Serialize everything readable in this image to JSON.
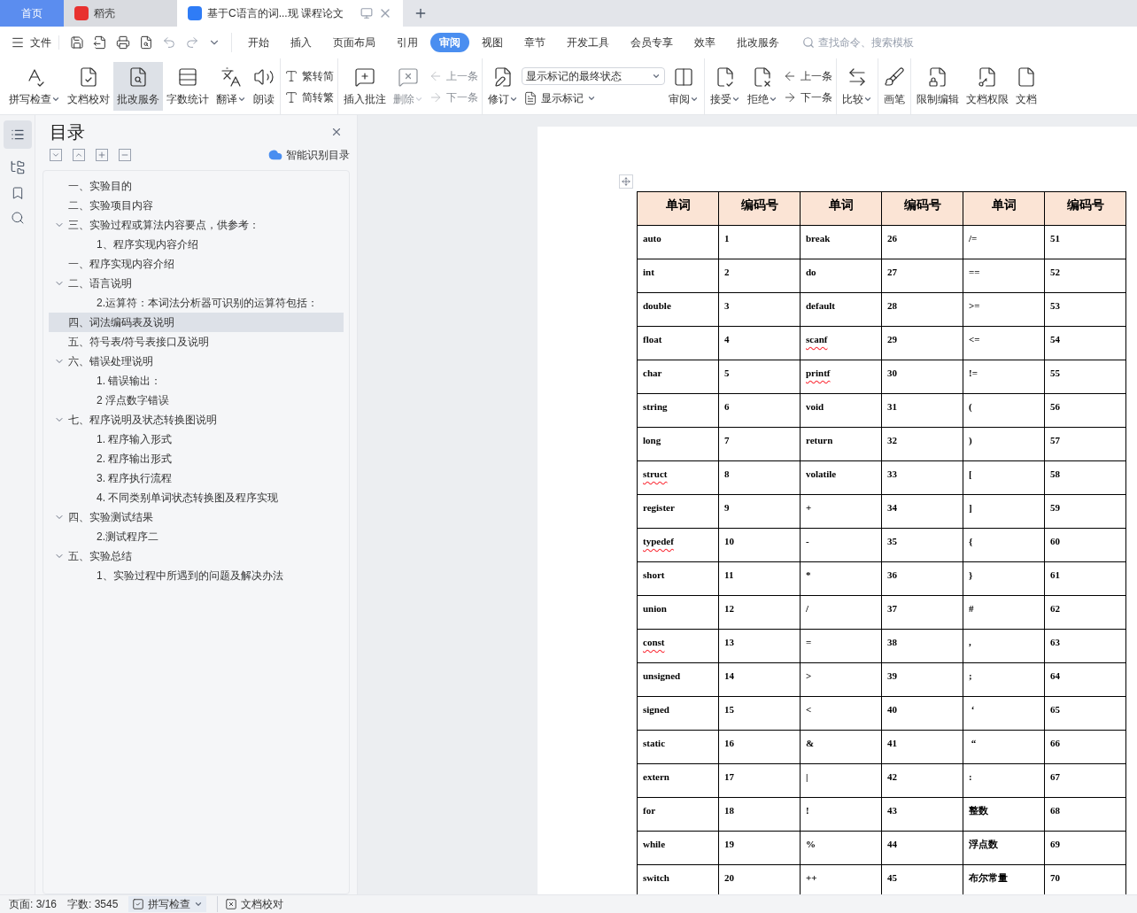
{
  "tabs": [
    {
      "label": "首页",
      "kind": "home",
      "selected": false
    },
    {
      "label": "稻壳",
      "kind": "app",
      "selected": false
    },
    {
      "label": "基于C语言的词...现  课程论文",
      "kind": "doc",
      "selected": true
    }
  ],
  "file_menu": "文件",
  "ribbon_tabs": [
    {
      "label": "开始",
      "selected": false
    },
    {
      "label": "插入",
      "selected": false
    },
    {
      "label": "页面布局",
      "selected": false
    },
    {
      "label": "引用",
      "selected": false
    },
    {
      "label": "审阅",
      "selected": true
    },
    {
      "label": "视图",
      "selected": false
    },
    {
      "label": "章节",
      "selected": false
    },
    {
      "label": "开发工具",
      "selected": false
    },
    {
      "label": "会员专享",
      "selected": false
    },
    {
      "label": "效率",
      "selected": false
    },
    {
      "label": "批改服务",
      "selected": false
    }
  ],
  "search": {
    "placeholder": "查找命令、搜索模板"
  },
  "ribbon_groups": [
    {
      "items": [
        {
          "kind": "large",
          "label": "拼写检查",
          "caret": true,
          "disabled": false,
          "selected": false
        },
        {
          "kind": "large",
          "label": "文档校对",
          "caret": false,
          "disabled": false,
          "selected": false
        },
        {
          "kind": "large",
          "label": "批改服务",
          "caret": false,
          "disabled": false,
          "selected": true
        },
        {
          "kind": "large",
          "label": "字数统计",
          "caret": false,
          "disabled": false,
          "selected": false
        },
        {
          "kind": "large",
          "label": "翻译",
          "caret": true,
          "disabled": false,
          "selected": false
        },
        {
          "kind": "large",
          "label": "朗读",
          "caret": false,
          "disabled": false,
          "selected": false
        }
      ]
    },
    {
      "items": [
        {
          "kind": "stack",
          "entries": [
            {
              "kind": "small",
              "label": "繁转简",
              "caret": false,
              "disabled": false
            },
            {
              "kind": "small",
              "label": "简转繁",
              "caret": false,
              "disabled": false
            }
          ]
        }
      ]
    },
    {
      "items": [
        {
          "kind": "large",
          "label": "插入批注",
          "caret": false,
          "disabled": false,
          "selected": false
        },
        {
          "kind": "large",
          "label": "删除",
          "caret": true,
          "disabled": true,
          "selected": false
        },
        {
          "kind": "stack",
          "entries": [
            {
              "kind": "small",
              "label": "上一条",
              "caret": false,
              "disabled": true
            },
            {
              "kind": "small",
              "label": "下一条",
              "caret": false,
              "disabled": true
            }
          ]
        }
      ]
    },
    {
      "items": [
        {
          "kind": "large",
          "label": "修订",
          "caret": true,
          "disabled": false,
          "selected": false
        },
        {
          "kind": "stack",
          "entries": [
            {
              "kind": "select",
              "label": "显示标记的最终状态"
            },
            {
              "kind": "small",
              "label": "显示标记",
              "caret": true,
              "disabled": false
            }
          ]
        },
        {
          "kind": "large",
          "label": "审阅",
          "caret": true,
          "disabled": false,
          "selected": false
        }
      ]
    },
    {
      "items": [
        {
          "kind": "large",
          "label": "接受",
          "caret": true,
          "disabled": false,
          "selected": false
        },
        {
          "kind": "large",
          "label": "拒绝",
          "caret": true,
          "disabled": false,
          "selected": false
        },
        {
          "kind": "stack",
          "entries": [
            {
              "kind": "small",
              "label": "上一条",
              "caret": false,
              "disabled": false
            },
            {
              "kind": "small",
              "label": "下一条",
              "caret": false,
              "disabled": false
            }
          ]
        }
      ]
    },
    {
      "items": [
        {
          "kind": "large",
          "label": "比较",
          "caret": true,
          "disabled": false,
          "selected": false
        }
      ]
    },
    {
      "items": [
        {
          "kind": "large",
          "label": "画笔",
          "caret": false,
          "disabled": false,
          "selected": false
        }
      ]
    },
    {
      "items": [
        {
          "kind": "large",
          "label": "限制编辑",
          "caret": false,
          "disabled": false,
          "selected": false
        },
        {
          "kind": "large",
          "label": "文档权限",
          "caret": false,
          "disabled": false,
          "selected": false
        },
        {
          "kind": "large",
          "label": "文档",
          "caret": false,
          "disabled": false,
          "selected": false
        }
      ]
    }
  ],
  "toc": {
    "title": "目录",
    "smart_button": "智能识别目录",
    "items": [
      {
        "title": "一、实验目的",
        "selected": false
      },
      {
        "title": "二、实验项目内容",
        "selected": false
      },
      {
        "title": "三、实验过程或算法内容要点，供参考：",
        "selected": false,
        "expanded": true,
        "children": [
          {
            "title": "1、程序实现内容介绍",
            "selected": false
          }
        ]
      },
      {
        "title": "一、程序实现内容介绍",
        "selected": false
      },
      {
        "title": "二、语言说明",
        "selected": false,
        "expanded": true,
        "children": [
          {
            "title": "2.运算符：本词法分析器可识别的运算符包括：",
            "selected": false
          }
        ]
      },
      {
        "title": "四、词法编码表及说明",
        "selected": true
      },
      {
        "title": "五、符号表/符号表接口及说明",
        "selected": false
      },
      {
        "title": "六、错误处理说明",
        "selected": false,
        "expanded": true,
        "children": [
          {
            "title": "1.   错误输出：",
            "selected": false
          },
          {
            "title": "2  浮点数字错误",
            "selected": false
          }
        ]
      },
      {
        "title": "七、程序说明及状态转换图说明",
        "selected": false,
        "expanded": true,
        "children": [
          {
            "title": "1. 程序输入形式",
            "selected": false
          },
          {
            "title": "2. 程序输出形式",
            "selected": false
          },
          {
            "title": "3. 程序执行流程",
            "selected": false
          },
          {
            "title": "4. 不同类别单词状态转换图及程序实现",
            "selected": false
          }
        ]
      },
      {
        "title": "四、实验测试结果",
        "selected": false,
        "expanded": true,
        "children": [
          {
            "title": "2.测试程序二",
            "selected": false
          }
        ]
      },
      {
        "title": "五、实验总结",
        "selected": false,
        "expanded": true,
        "children": [
          {
            "title": "1、实验过程中所遇到的问题及解决办法",
            "selected": false
          }
        ]
      }
    ]
  },
  "table": {
    "columns": [
      "单词",
      "编码号",
      "单词",
      "编码号",
      "单词",
      "编码号"
    ],
    "rows": [
      {
        "cells": [
          "auto",
          "1",
          "break",
          "26",
          "/=",
          "51"
        ],
        "misspelled": [
          false,
          false,
          false
        ]
      },
      {
        "cells": [
          "int",
          "2",
          "do",
          "27",
          "==",
          "52"
        ],
        "misspelled": [
          false,
          false,
          false
        ]
      },
      {
        "cells": [
          "double",
          "3",
          "default",
          "28",
          ">=",
          "53"
        ],
        "misspelled": [
          false,
          false,
          false
        ]
      },
      {
        "cells": [
          "float",
          "4",
          "scanf",
          "29",
          "<=",
          "54"
        ],
        "misspelled": [
          false,
          true,
          false
        ]
      },
      {
        "cells": [
          "char",
          "5",
          "printf",
          "30",
          "!=",
          "55"
        ],
        "misspelled": [
          false,
          true,
          false
        ]
      },
      {
        "cells": [
          "string",
          "6",
          "void",
          "31",
          "(",
          "56"
        ],
        "misspelled": [
          false,
          false,
          false
        ]
      },
      {
        "cells": [
          "long",
          "7",
          "return",
          "32",
          ")",
          "57"
        ],
        "misspelled": [
          false,
          false,
          false
        ]
      },
      {
        "cells": [
          "struct",
          "8",
          "volatile",
          "33",
          "[",
          "58"
        ],
        "misspelled": [
          true,
          false,
          false
        ]
      },
      {
        "cells": [
          "register",
          "9",
          "+",
          "34",
          "]",
          "59"
        ],
        "misspelled": [
          false,
          false,
          false
        ]
      },
      {
        "cells": [
          "typedef",
          "10",
          "-",
          "35",
          "{",
          "60"
        ],
        "misspelled": [
          true,
          false,
          false
        ]
      },
      {
        "cells": [
          "short",
          "11",
          "*",
          "36",
          "}",
          "61"
        ],
        "misspelled": [
          false,
          false,
          false
        ]
      },
      {
        "cells": [
          "union",
          "12",
          "/",
          "37",
          "#",
          "62"
        ],
        "misspelled": [
          false,
          false,
          false
        ]
      },
      {
        "cells": [
          "const",
          "13",
          "=",
          "38",
          ",",
          "63"
        ],
        "misspelled": [
          true,
          false,
          false
        ]
      },
      {
        "cells": [
          "unsigned",
          "14",
          ">",
          "39",
          ";",
          "64"
        ],
        "misspelled": [
          false,
          false,
          false
        ]
      },
      {
        "cells": [
          "signed",
          "15",
          "<",
          "40",
          " ‘",
          "65"
        ],
        "misspelled": [
          false,
          false,
          false
        ]
      },
      {
        "cells": [
          "static",
          "16",
          "&",
          "41",
          " “",
          "66"
        ],
        "misspelled": [
          false,
          false,
          false
        ]
      },
      {
        "cells": [
          "extern",
          "17",
          "|",
          "42",
          ":",
          "67"
        ],
        "misspelled": [
          false,
          false,
          false
        ]
      },
      {
        "cells": [
          "for",
          "18",
          "!",
          "43",
          "整数",
          "68"
        ],
        "misspelled": [
          false,
          false,
          false
        ]
      },
      {
        "cells": [
          "while",
          "19",
          "%",
          "44",
          "浮点数",
          "69"
        ],
        "misspelled": [
          false,
          false,
          false
        ]
      },
      {
        "cells": [
          "switch",
          "20",
          "++",
          "45",
          "布尔常量",
          "70"
        ],
        "misspelled": [
          false,
          false,
          false
        ]
      }
    ]
  },
  "status_bar": {
    "page": "页面: 3/16",
    "words": "字数: 3545",
    "spell_check": "拼写检查",
    "proofread": "文档校对"
  }
}
